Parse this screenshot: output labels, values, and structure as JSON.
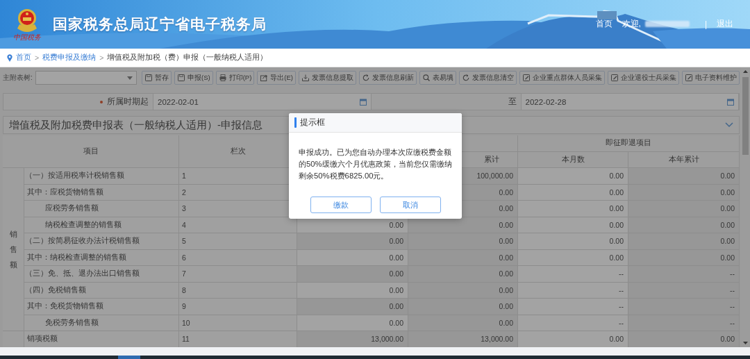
{
  "header": {
    "logo_text": "中国税务",
    "title": "国家税务总局辽宁省电子税务局",
    "home": "首页",
    "welcome": "欢迎,",
    "divider": "|",
    "logout": "退出"
  },
  "breadcrumb": [
    {
      "label": "首页",
      "kind": "link",
      "separator": ">"
    },
    {
      "label": "税费申报及缴纳",
      "kind": "link",
      "separator": ">"
    },
    {
      "label": "增值税及附加税（费）申报（一般纳税人适用）",
      "kind": "current"
    }
  ],
  "toolbar": {
    "tree_label": "主附表树:",
    "buttons": [
      {
        "label": "暂存",
        "kind": "save"
      },
      {
        "label": "申报(S)",
        "kind": "save"
      },
      {
        "label": "打印(P)",
        "kind": "print"
      },
      {
        "label": "导出(E)",
        "kind": "export"
      },
      {
        "label": "发票信息提取",
        "kind": "download"
      },
      {
        "label": "发票信息刷新",
        "kind": "refresh"
      },
      {
        "label": "表易填",
        "kind": "search"
      },
      {
        "label": "发票信息清空",
        "kind": "refresh"
      },
      {
        "label": "企业重点群体人员采集",
        "kind": "edit"
      },
      {
        "label": "企业退役士兵采集",
        "kind": "edit"
      },
      {
        "label": "电子资料维护",
        "kind": "edit"
      }
    ]
  },
  "period": {
    "required": true,
    "from_label": "所属时期起",
    "from": "2022-02-01",
    "to_label": "至",
    "to": "2022-02-28"
  },
  "section": {
    "title": "增值税及附加税费申报表（一般纳税人适用）-申报信息",
    "expanded": true
  },
  "table": {
    "headers": {
      "item": "项目",
      "line": "栏次",
      "general_year": "累计",
      "refund": "即征即退项目",
      "refund_month": "本月数",
      "refund_year": "本年累计"
    },
    "group": {
      "label": "销售额",
      "rows": [
        {
          "item": "（一）按适用税率计税销售额",
          "kind": "main",
          "line": "1",
          "general_year": "100,000.00",
          "refund_month": "0.00",
          "refund_year": "0.00"
        },
        {
          "item": "其中：应税货物销售额",
          "kind": "sub",
          "line": "2",
          "general_year": "0.00",
          "refund_month": "0.00",
          "refund_year": "0.00"
        },
        {
          "item": "应税劳务销售额",
          "kind": "indent",
          "line": "3",
          "general_year": "0.00",
          "refund_month": "0.00",
          "refund_year": "0.00"
        },
        {
          "item": "纳税检查调整的销售额",
          "kind": "indent",
          "line": "4",
          "general_month": "0.00",
          "general_year": "0.00",
          "refund_month": "0.00",
          "refund_year": "0.00"
        },
        {
          "item": "（二）按简易征收办法计税销售额",
          "kind": "main",
          "line": "5",
          "general_month": "0.00",
          "general_year": "0.00",
          "refund_month": "0.00",
          "refund_year": "0.00"
        },
        {
          "item": "其中：纳税检查调整的销售额",
          "kind": "sub",
          "line": "6",
          "general_month": "0.00",
          "general_year": "0.00",
          "refund_month": "0.00",
          "refund_year": "0.00"
        },
        {
          "item": "（三）免、抵、退办法出口销售额",
          "kind": "main",
          "line": "7",
          "general_month": "0.00",
          "general_year": "0.00",
          "refund_month": "--",
          "refund_year": "--"
        },
        {
          "item": "（四）免税销售额",
          "kind": "main",
          "line": "8",
          "general_month": "0.00",
          "general_year": "0.00",
          "refund_month": "--",
          "refund_year": "--"
        },
        {
          "item": "其中：免税货物销售额",
          "kind": "sub",
          "line": "9",
          "general_month": "0.00",
          "general_year": "0.00",
          "refund_month": "--",
          "refund_year": "--"
        },
        {
          "item": "免税劳务销售额",
          "kind": "indent",
          "line": "10",
          "general_month": "0.00",
          "general_year": "0.00",
          "refund_month": "--",
          "refund_year": "--"
        }
      ]
    },
    "rows": [
      {
        "item": "销项税额",
        "kind": "sub",
        "line": "11",
        "general_month": "13,000.00",
        "general_year": "13,000.00",
        "refund_month": "0.00",
        "refund_year": "0.00"
      }
    ]
  },
  "dialog": {
    "title": "提示框",
    "message": "申报成功。已为您自动办理本次应缴税费金额的50%缓缴六个月优惠政策，当前您仅需缴纳剩余50%税费6825.00元。",
    "buttons": [
      "缴款",
      "取消"
    ]
  }
}
